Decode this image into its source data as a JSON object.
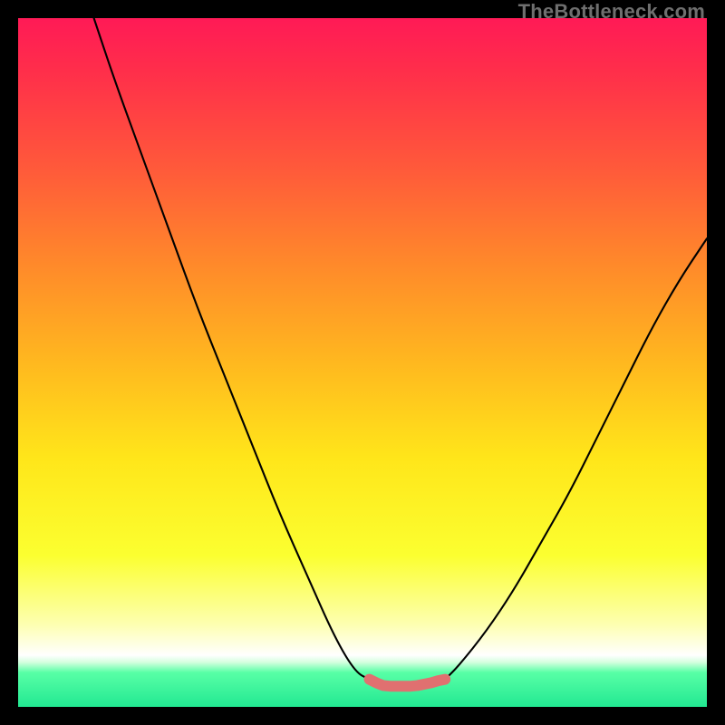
{
  "watermark": "TheBottleneck.com",
  "colors": {
    "background": "#000000",
    "curve_stroke": "#000000",
    "marker_fill": "#e07070",
    "gradient_top": "#ff1a56",
    "gradient_mid1": "#ff8a2a",
    "gradient_mid2": "#ffe61a",
    "gradient_white_band": "#ffffff",
    "gradient_bottom": "#22e892"
  },
  "chart_data": {
    "type": "line",
    "title": "",
    "xlabel": "",
    "ylabel": "",
    "xlim": [
      0,
      100
    ],
    "ylim": [
      0,
      100
    ],
    "grid": false,
    "legend": "none",
    "series": [
      {
        "name": "left-branch",
        "x": [
          11,
          14,
          18,
          22,
          26,
          30,
          34,
          38,
          42,
          46,
          49,
          51
        ],
        "y": [
          100,
          91,
          80,
          69,
          58,
          48,
          38,
          28,
          19,
          10,
          5,
          4
        ]
      },
      {
        "name": "right-branch",
        "x": [
          62,
          64,
          68,
          72,
          76,
          80,
          84,
          88,
          92,
          96,
          100
        ],
        "y": [
          4,
          6,
          11,
          17,
          24,
          31,
          39,
          47,
          55,
          62,
          68
        ]
      },
      {
        "name": "bottom-marker",
        "style": "scatter",
        "x": [
          51,
          52,
          53,
          54,
          55,
          56,
          57,
          58,
          59,
          60,
          61,
          62
        ],
        "y": [
          4,
          3.5,
          3.1,
          3.0,
          3.0,
          3.0,
          3.0,
          3.1,
          3.3,
          3.5,
          3.8,
          4
        ]
      }
    ],
    "annotations": []
  }
}
